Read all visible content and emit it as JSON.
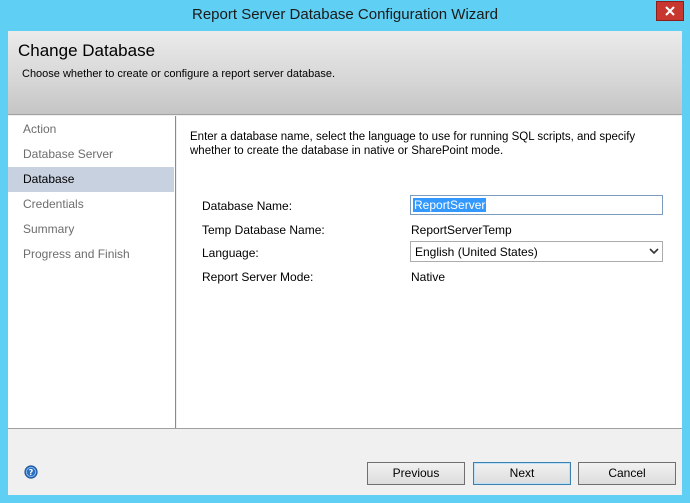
{
  "window": {
    "title": "Report Server Database Configuration Wizard"
  },
  "header": {
    "title": "Change Database",
    "subtitle": "Choose whether to create or configure a report server database."
  },
  "nav": {
    "items": [
      {
        "label": "Action",
        "selected": false
      },
      {
        "label": "Database Server",
        "selected": false
      },
      {
        "label": "Database",
        "selected": true
      },
      {
        "label": "Credentials",
        "selected": false
      },
      {
        "label": "Summary",
        "selected": false
      },
      {
        "label": "Progress and Finish",
        "selected": false
      }
    ]
  },
  "content": {
    "intro": "Enter a database name, select the language to use for running SQL scripts, and specify whether to create the database in native or SharePoint mode.",
    "database_name_label": "Database Name:",
    "database_name_value": "ReportServer",
    "temp_database_label": "Temp Database Name:",
    "temp_database_value": "ReportServerTemp",
    "language_label": "Language:",
    "language_value": "English (United States)",
    "mode_label": "Report Server Mode:",
    "mode_value": "Native"
  },
  "footer": {
    "previous_label": "Previous",
    "next_label": "Next",
    "cancel_label": "Cancel"
  },
  "icons": {
    "close": "close-icon",
    "help": "help-icon",
    "dropdown": "chevron-down-icon"
  },
  "colors": {
    "window_frame": "#5fcff4",
    "close_button": "#c7372f",
    "nav_selected": "#c8d1e0",
    "text_selection": "#3399ff"
  }
}
